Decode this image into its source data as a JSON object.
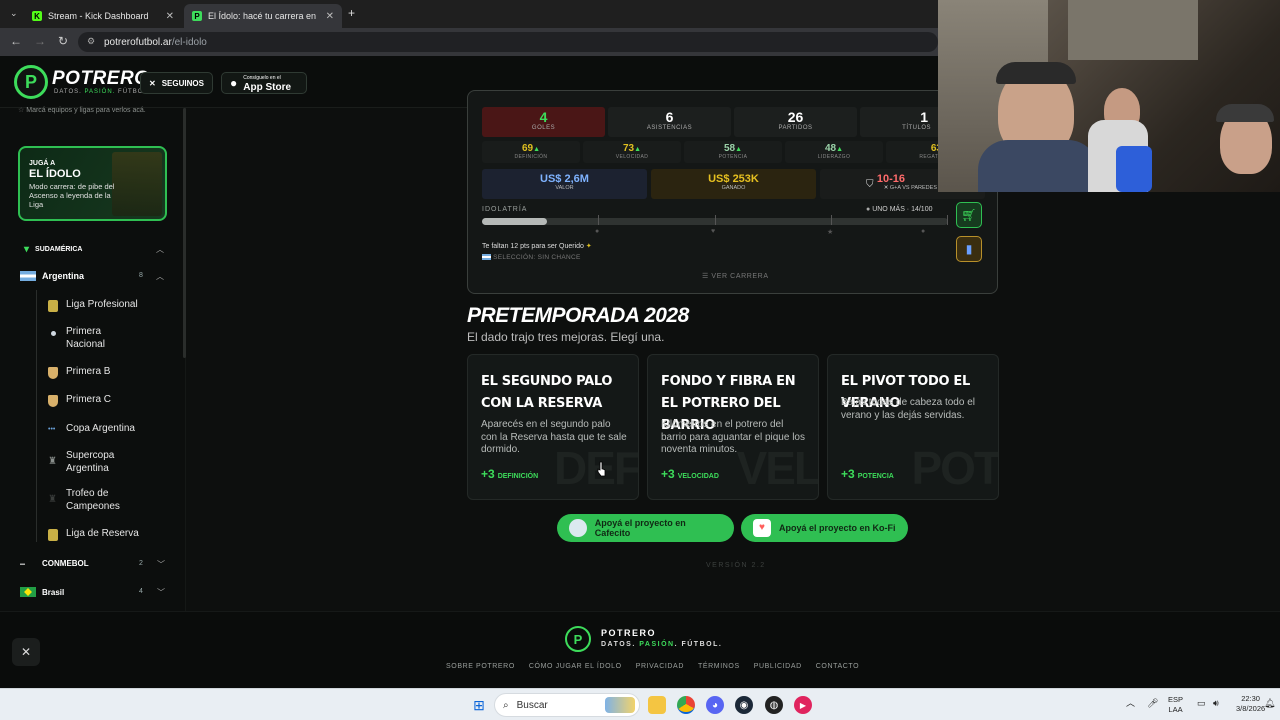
{
  "browser": {
    "tabs": [
      {
        "label": "Stream - Kick Dashboard",
        "favicon": "K",
        "active": false
      },
      {
        "label": "El Ídolo: hacé tu carrera en la Li",
        "favicon": "P",
        "active": true
      }
    ],
    "new_tab": "+",
    "url_host": "potrerofutbol.ar",
    "url_path": "/el-idolo"
  },
  "header": {
    "logo_letter": "P",
    "logo_name": "POTRERO",
    "tagline_a": "DATOS. ",
    "tagline_b": "PASIÓN.",
    "tagline_c": " FÚTBOL.",
    "follow_label": "SEGUINOS",
    "appstore_small": "Consíguelo en el",
    "appstore_big": "App Store"
  },
  "sidebar": {
    "hint": "Marcá equipos y ligas para verlos acá.",
    "idolo": {
      "kicker": "JUGÁ A",
      "title": "EL ÍDOLO",
      "desc": "Modo carrera: de pibe del Ascenso a leyenda de la Liga"
    },
    "region": "SUDAMÉRICA",
    "argentina": {
      "label": "Argentina",
      "count": "8"
    },
    "leagues": [
      {
        "label": "Liga Profesional",
        "color": "#c9b046"
      },
      {
        "label": "Primera Nacional",
        "color": "#cfd8e0"
      },
      {
        "label": "Primera B",
        "color": "#d8b06a"
      },
      {
        "label": "Primera C",
        "color": "#d8b06a"
      },
      {
        "label": "Copa Argentina",
        "color": "#6aa0d8"
      },
      {
        "label": "Supercopa Argentina",
        "color": "#8a8f8c"
      },
      {
        "label": "Trofeo de Campeones",
        "color": "#3a3d3b"
      },
      {
        "label": "Liga de Reserva",
        "color": "#c9b046"
      }
    ],
    "conmebol": {
      "label": "CONMEBOL",
      "count": "2"
    },
    "brasil": {
      "label": "Brasil",
      "count": "4"
    }
  },
  "career": {
    "stats": [
      {
        "value": "4",
        "label": "GOLES"
      },
      {
        "value": "6",
        "label": "ASISTENCIAS"
      },
      {
        "value": "26",
        "label": "PARTIDOS"
      },
      {
        "value": "1",
        "label": "TÍTULOS"
      }
    ],
    "attributes": [
      {
        "value": "69",
        "label": "DEFINICIÓN"
      },
      {
        "value": "73",
        "label": "VELOCIDAD"
      },
      {
        "value": "58",
        "label": "POTENCIA"
      },
      {
        "value": "48",
        "label": "LIDERAZGO"
      },
      {
        "value": "63",
        "label": "REGATE"
      }
    ],
    "money": [
      {
        "value": "US$ 2,6M",
        "label": "VALOR"
      },
      {
        "value": "US$ 253K",
        "label": "GANADO"
      },
      {
        "value": "10-16",
        "label": "G+A VS PAREDES"
      }
    ],
    "idolatria_label": "IDOLATRÍA",
    "idolatria_status": "UNO MÁS · 14/100",
    "idolatria_progress": 0.14,
    "faltan": "Te faltan 12 pts para ser Querido",
    "seleccion": "SELECCIÓN: SIN CHANCE",
    "ver_carrera": "VER CARRERA"
  },
  "pretemporada": {
    "title": "PRETEMPORADA 2028",
    "subtitle": "El dado trajo tres mejoras. Elegí una.",
    "options": [
      {
        "title": "EL SEGUNDO PALO CON LA RESERVA",
        "desc": "Aparecés en el segundo palo con la Reserva hasta que te sale dormido.",
        "bonus": "+3",
        "attr": "DEFINICIÓN",
        "watermark": "DEF"
      },
      {
        "title": "FONDO Y FIBRA EN EL POTRERO DEL BARRIO",
        "desc": "Kilómetros en el potrero del barrio para aguantar el pique los noventa minutos.",
        "bonus": "+3",
        "attr": "VELOCIDAD",
        "watermark": "VEL"
      },
      {
        "title": "EL PIVOT TODO EL VERANO",
        "desc": "Bajás todas de cabeza todo el verano y las dejás servidas.",
        "bonus": "+3",
        "attr": "POTENCIA",
        "watermark": "POT"
      }
    ]
  },
  "support": {
    "cafecito": "Apoyá el proyecto en Cafecito",
    "kofi": "Apoyá el proyecto en Ko-Fi"
  },
  "version": "VERSIÓN 2.2",
  "footer": {
    "name": "POTRERO",
    "tag_a": "DATOS. ",
    "tag_b": "PASIÓN",
    "tag_c": ". FÚTBOL.",
    "links": [
      "SOBRE POTRERO",
      "CÓMO JUGAR EL ÍDOLO",
      "PRIVACIDAD",
      "TÉRMINOS",
      "PUBLICIDAD",
      "CONTACTO"
    ]
  },
  "taskbar": {
    "search": "Buscar",
    "lang_a": "ESP",
    "lang_b": "LAA",
    "time": "22:30",
    "date": "3/8/2026"
  },
  "colors": {
    "accent": "#3ddc5b",
    "gold": "#e0c020",
    "bg": "#0d0f0e"
  }
}
